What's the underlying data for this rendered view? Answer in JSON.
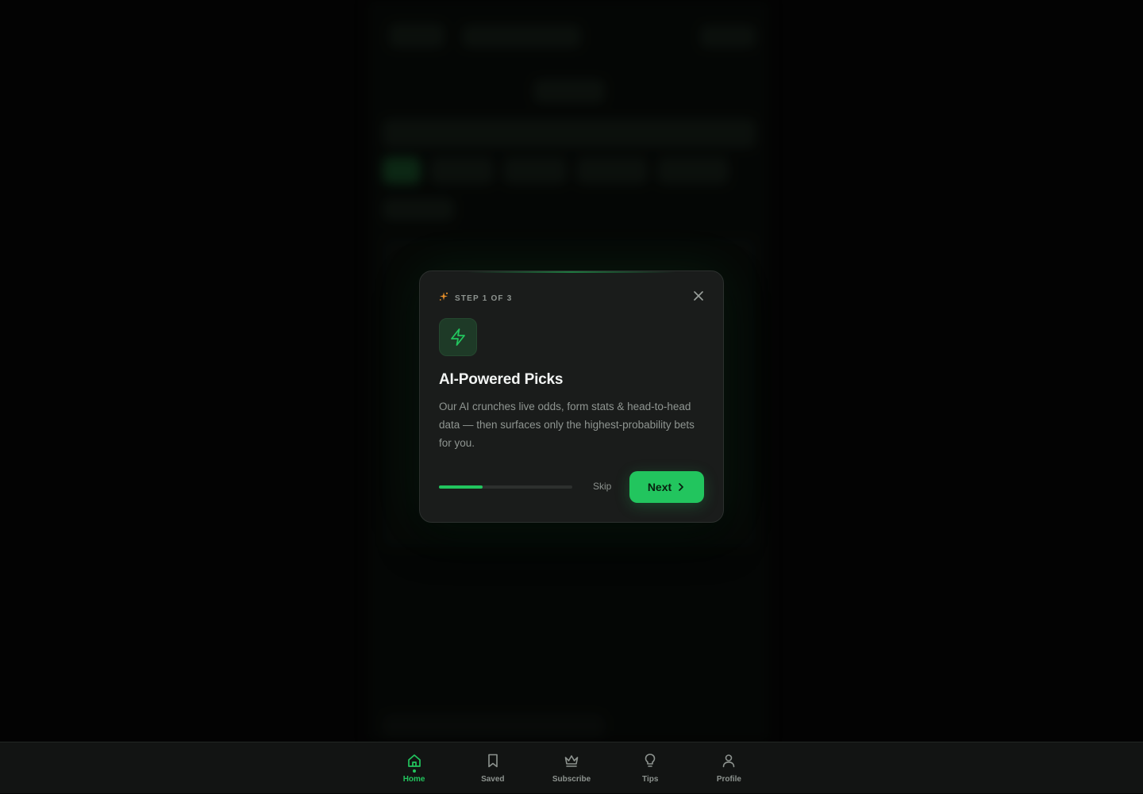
{
  "onboarding": {
    "step_label": "STEP 1 OF 3",
    "title": "AI-Powered Picks",
    "description": "Our AI crunches live odds, form stats & head-to-head data — then surfaces only the highest-probability bets for you.",
    "progress": 0.33,
    "skip_label": "Skip",
    "next_label": "Next",
    "accent_color": "#22c55e",
    "step_icon": "sparkle-icon",
    "feature_icon": "lightning-bolt-icon"
  },
  "bottom_nav": {
    "items": [
      {
        "label": "Home",
        "icon": "home-icon",
        "active": true
      },
      {
        "label": "Saved",
        "icon": "bookmark-icon",
        "active": false
      },
      {
        "label": "Subscribe",
        "icon": "crown-icon",
        "active": false
      },
      {
        "label": "Tips",
        "icon": "lightbulb-icon",
        "active": false
      },
      {
        "label": "Profile",
        "icon": "user-icon",
        "active": false
      }
    ]
  }
}
